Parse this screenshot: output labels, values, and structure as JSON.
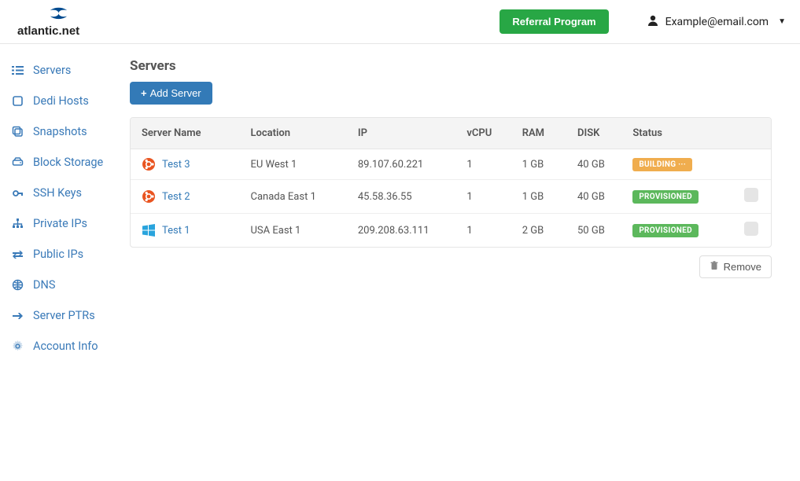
{
  "header": {
    "brand": "atlantic.net",
    "referral_label": "Referral Program",
    "user_email": "Example@email.com"
  },
  "sidebar": {
    "items": [
      {
        "label": "Servers",
        "icon": "list-icon"
      },
      {
        "label": "Dedi Hosts",
        "icon": "square-icon"
      },
      {
        "label": "Snapshots",
        "icon": "copy-icon"
      },
      {
        "label": "Block Storage",
        "icon": "hdd-icon"
      },
      {
        "label": "SSH Keys",
        "icon": "key-icon"
      },
      {
        "label": "Private IPs",
        "icon": "sitemap-icon"
      },
      {
        "label": "Public IPs",
        "icon": "exchange-icon"
      },
      {
        "label": "DNS",
        "icon": "globe-icon"
      },
      {
        "label": "Server PTRs",
        "icon": "arrow-right-icon"
      },
      {
        "label": "Account Info",
        "icon": "gear-icon"
      }
    ]
  },
  "page": {
    "title": "Servers",
    "add_button": "Add Server",
    "remove_button": "Remove"
  },
  "table": {
    "headers": [
      "Server Name",
      "Location",
      "IP",
      "vCPU",
      "RAM",
      "DISK",
      "Status"
    ],
    "rows": [
      {
        "os": "ubuntu",
        "name": "Test 3",
        "location": "EU West 1",
        "ip": "89.107.60.221",
        "vcpu": "1",
        "ram": "1 GB",
        "disk": "40 GB",
        "status": "BUILDING ···",
        "status_kind": "building",
        "selectable": false
      },
      {
        "os": "ubuntu",
        "name": "Test 2",
        "location": "Canada East 1",
        "ip": "45.58.36.55",
        "vcpu": "1",
        "ram": "1 GB",
        "disk": "40 GB",
        "status": "PROVISIONED",
        "status_kind": "provisioned",
        "selectable": true
      },
      {
        "os": "windows",
        "name": "Test 1",
        "location": "USA East 1",
        "ip": "209.208.63.111",
        "vcpu": "1",
        "ram": "2 GB",
        "disk": "50 GB",
        "status": "PROVISIONED",
        "status_kind": "provisioned",
        "selectable": true
      }
    ]
  }
}
